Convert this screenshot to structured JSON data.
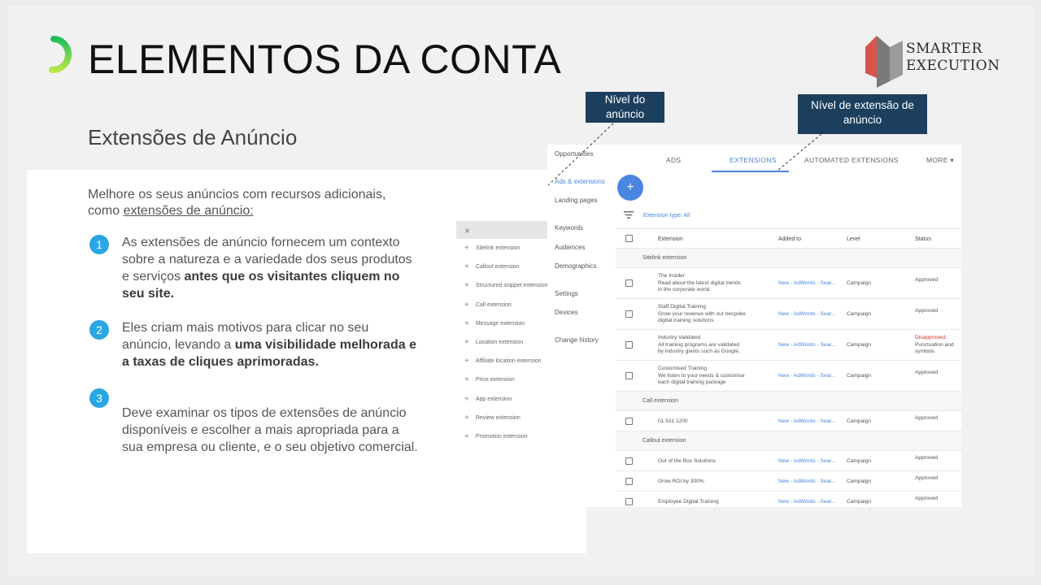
{
  "slide": {
    "title": "ELEMENTOS DA CONTA",
    "subtitle": "Extensões de Anúncio",
    "brand_line1": "SMARTER",
    "brand_line2": "EXECUTION",
    "intro_text": "Melhore os seus anúncios com recursos adicionais, como ",
    "intro_link": "extensões de anúncio:",
    "points": [
      {
        "num": "1",
        "text": "As extensões de anúncio fornecem um contexto sobre a natureza e a variedade dos seus produtos e serviços ",
        "bold": "antes que os visitantes cliquem no seu site."
      },
      {
        "num": "2",
        "text": "Eles criam mais motivos para clicar no seu anúncio, levando a ",
        "bold": "uma visibilidade melhorada e a taxas de cliques aprimoradas."
      },
      {
        "num": "3",
        "text": "Deve examinar os tipos de extensões de anúncio disponíveis e escolher a mais apropriada para a sua empresa ou cliente, e o seu objetivo comercial.",
        "bold": ""
      }
    ],
    "callouts": {
      "ad_level": "Nível do anúncio",
      "extension_level": "Nível de extensão de anúncio"
    },
    "colors": {
      "accent": "#29a6e3",
      "callout_bg": "#1c3f5e",
      "link": "#4a85e0",
      "logo_red": "#d9534f",
      "logo_gray": "#7a7a7a"
    }
  },
  "screenshot": {
    "submenu": {
      "close": "×",
      "items": [
        "Sitelink extension",
        "Callout extension",
        "Structured snippet extension",
        "Call extension",
        "Message extension",
        "Location extension",
        "Affiliate location extension",
        "Price extension",
        "App extension",
        "Review extension",
        "Promotion extension"
      ]
    },
    "nav": [
      "Opportunities",
      "Ads & extensions",
      "Landing pages",
      "Keywords",
      "Audiences",
      "Demographics",
      "Settings",
      "Devices",
      "Change history"
    ],
    "tabs": [
      "ADS",
      "EXTENSIONS",
      "AUTOMATED EXTENSIONS",
      "MORE ▾"
    ],
    "fab": "+",
    "filter": "Extension type: All",
    "columns": [
      "Extension",
      "Added to",
      "Level",
      "Status"
    ],
    "groups": [
      {
        "name": "Sitelink extension",
        "rows": [
          {
            "ext": [
              "The Insider",
              "Read about the latest digital trends",
              "in the corporate world."
            ],
            "added": "New - AdWords - Sear...",
            "level": "Campaign",
            "status": [
              "Approved"
            ],
            "disapproved": false
          },
          {
            "ext": [
              "Staff Digital Training",
              "Grow your revenue with our bespoke",
              "digital training solutions"
            ],
            "added": "New - AdWords - Sear...",
            "level": "Campaign",
            "status": [
              "Approved"
            ],
            "disapproved": false
          },
          {
            "ext": [
              "Industry Validated",
              "All training programs are validated",
              "by industry giants such as Google."
            ],
            "added": "New - AdWords - Sear...",
            "level": "Campaign",
            "status": [
              "Disapproved:",
              "Punctuation and",
              "symbols"
            ],
            "disapproved": true
          },
          {
            "ext": [
              "Customised Training",
              "We listen to your needs & customise",
              "each digital training package"
            ],
            "added": "New - AdWords - Sear...",
            "level": "Campaign",
            "status": [
              "Approved"
            ],
            "disapproved": false
          }
        ]
      },
      {
        "name": "Call extension",
        "rows": [
          {
            "ext": [
              "01 531 1200"
            ],
            "added": "New - AdWords - Sear...",
            "level": "Campaign",
            "status": [
              "Approved"
            ],
            "disapproved": false
          }
        ]
      },
      {
        "name": "Callout extension",
        "rows": [
          {
            "ext": [
              "Out of the Box Solutions"
            ],
            "added": "New - AdWords - Sear...",
            "level": "Campaign",
            "status": [
              "Approved"
            ],
            "disapproved": false
          },
          {
            "ext": [
              "Grow ROI by 300%"
            ],
            "added": "New - AdWords - Sear...",
            "level": "Campaign",
            "status": [
              "Approved"
            ],
            "disapproved": false
          },
          {
            "ext": [
              "Employee Digital Training"
            ],
            "added": "New - AdWords - Sear...",
            "level": "Campaign",
            "status": [
              "Approved"
            ],
            "disapproved": false
          }
        ]
      }
    ]
  }
}
